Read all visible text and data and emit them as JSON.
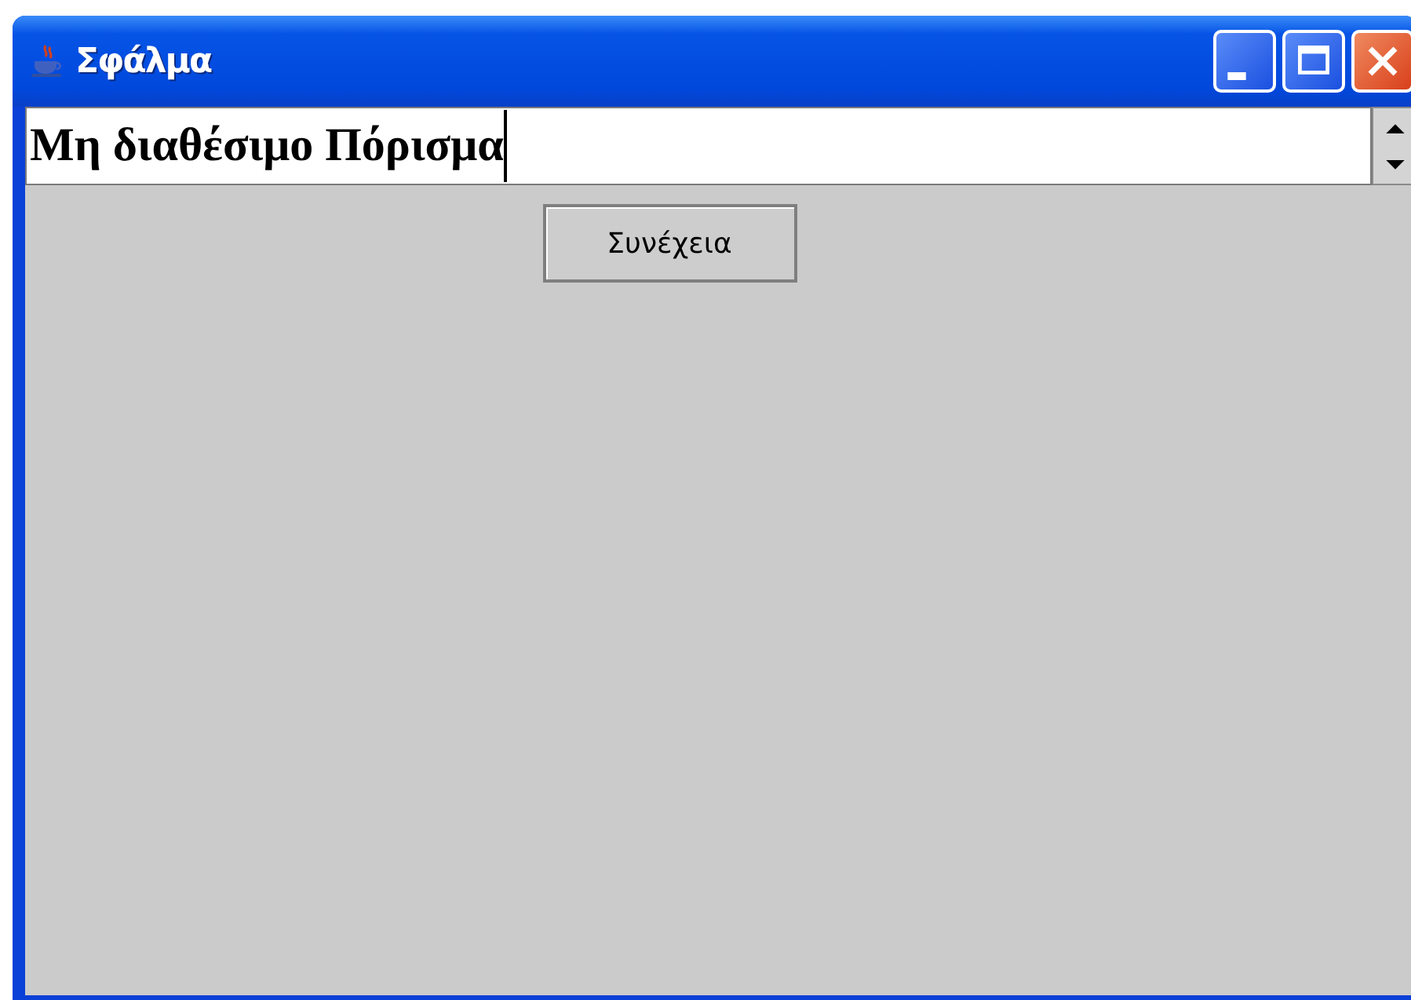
{
  "window": {
    "title": "Σφάλμα"
  },
  "message_field": {
    "value": "Μη διαθέσιμο Πόρισμα"
  },
  "buttons": [
    {
      "label": "Συνέχεια"
    }
  ]
}
